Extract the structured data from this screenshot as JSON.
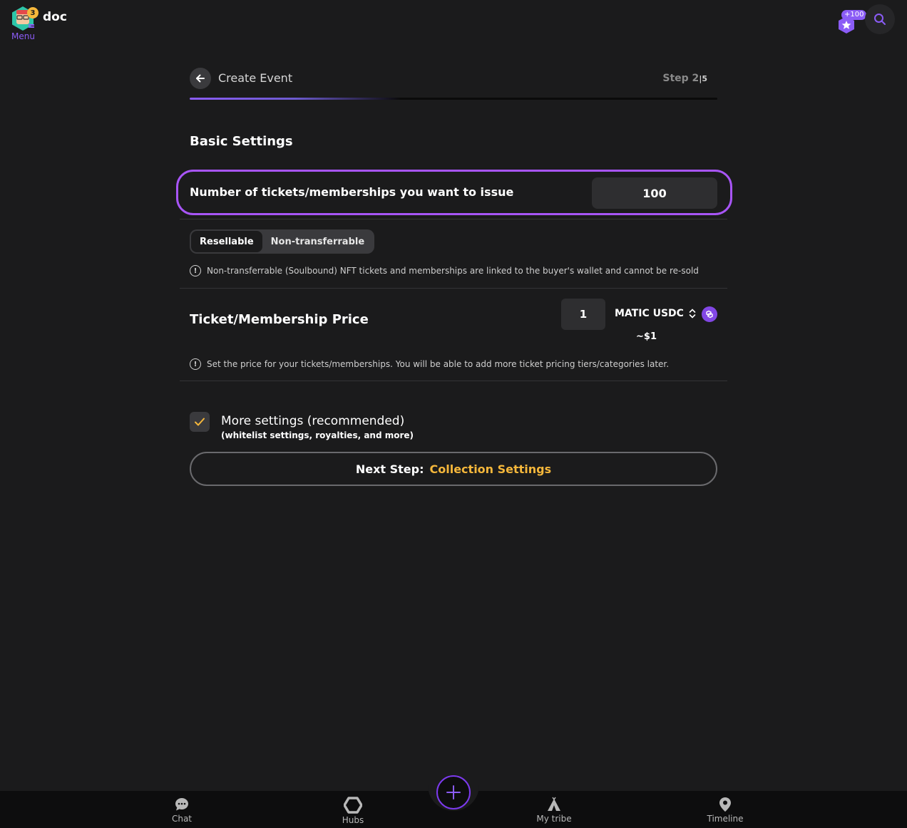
{
  "topbar": {
    "username": "doc",
    "menu_label": "Menu",
    "notification_count": "3",
    "points": "+100"
  },
  "header": {
    "title": "Create Event",
    "step_label": "Step 2",
    "step_total": "5",
    "progress": 0.4
  },
  "basic_settings": {
    "title": "Basic Settings",
    "tickets_label": "Number of tickets/memberships you want to issue",
    "tickets_value": "100",
    "toggle_options": [
      "Resellable",
      "Non-transferrable"
    ],
    "toggle_selected": "Resellable",
    "soulbound_info": "Non-transferrable (Soulbound) NFT tickets and memberships are linked to the buyer's wallet and cannot be re-sold"
  },
  "price": {
    "title": "Ticket/Membership Price",
    "value": "1",
    "currency": "MATIC USDC",
    "approx": "~$1",
    "info": "Set the price for your tickets/memberships. You will be able to add more ticket pricing tiers/categories later."
  },
  "more_settings": {
    "label": "More settings (recommended)",
    "sublabel": "(whitelist settings, royalties, and more)",
    "checked": true
  },
  "next_button": {
    "prefix": "Next Step:",
    "target": "Collection Settings"
  },
  "bottom_nav": {
    "items": [
      "Chat",
      "Hubs",
      "My tribe",
      "Timeline"
    ]
  },
  "colors": {
    "accent_purple": "#a855f7",
    "accent_yellow": "#f5b73b",
    "background": "#1b1b1c"
  }
}
